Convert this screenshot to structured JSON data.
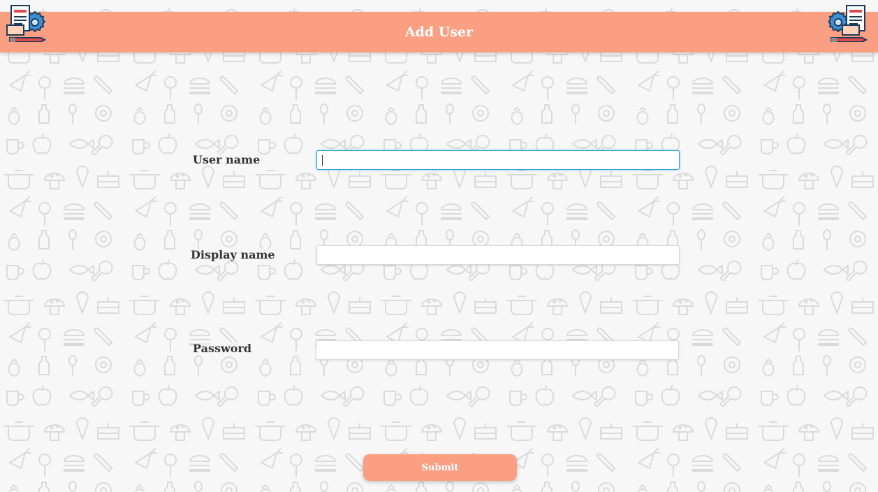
{
  "header": {
    "title": "Add User",
    "background_color": "#fb9f83",
    "left_logo_icon": "document-gear-pencil-icon",
    "right_logo_icon": "document-gear-pencil-icon"
  },
  "background": {
    "pattern": "food-doodle-pattern",
    "color": "#f7f7f7"
  },
  "form": {
    "fields": [
      {
        "label": "User name",
        "value": "",
        "placeholder": "",
        "type": "text",
        "focused": true
      },
      {
        "label": "Display name",
        "value": "",
        "placeholder": "",
        "type": "text",
        "focused": false
      },
      {
        "label": "Password",
        "value": "",
        "placeholder": "",
        "type": "password",
        "focused": false
      }
    ],
    "submit_label": "Submit",
    "accent_color": "#fb9f83",
    "focus_color": "#33a3dc"
  }
}
